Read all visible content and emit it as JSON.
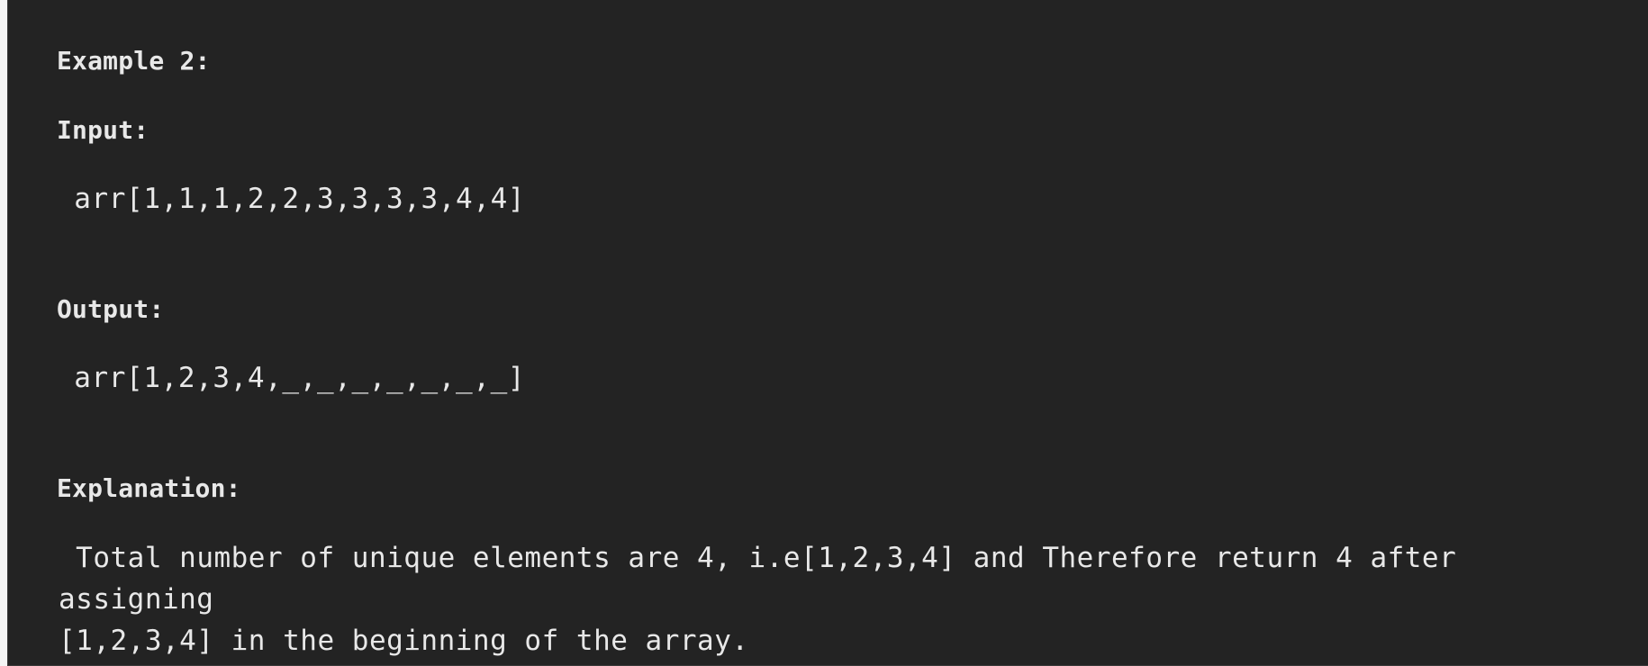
{
  "example": {
    "title": "Example 2:",
    "input_label": "Input:",
    "input_value": " arr[1,1,1,2,2,3,3,3,3,4,4]",
    "output_label": "Output:",
    "output_value": " arr[1,2,3,4,_,_,_,_,_,_,_]",
    "explanation_label": "Explanation:",
    "explanation_text": " Total number of unique elements are 4, i.e[1,2,3,4] and Therefore return 4 after assigning\n[1,2,3,4] in the beginning of the array."
  }
}
